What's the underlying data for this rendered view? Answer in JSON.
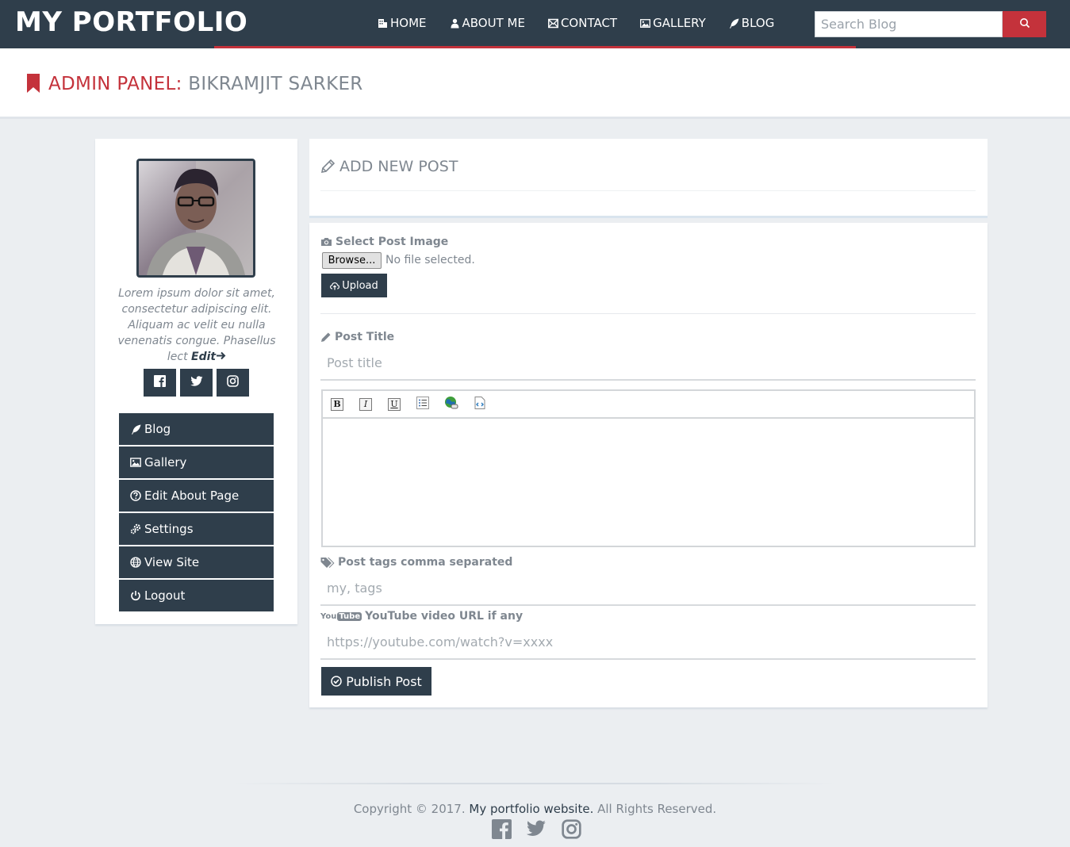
{
  "navbar": {
    "brand": "MY PORTFOLIO",
    "menu": [
      {
        "label": "HOME",
        "icon": "building-icon"
      },
      {
        "label": "ABOUT ME",
        "icon": "user-icon"
      },
      {
        "label": "CONTACT",
        "icon": "envelope-icon"
      },
      {
        "label": "GALLERY",
        "icon": "image-icon"
      },
      {
        "label": "BLOG",
        "icon": "feather-icon"
      }
    ],
    "search_placeholder": "Search Blog",
    "accent_color": "#c4323b",
    "bg_color": "#2f3e4b"
  },
  "header": {
    "accent_label": "ADMIN PANEL:",
    "name": "BIKRAMJIT SARKER"
  },
  "sidebar": {
    "bio": "Lorem ipsum dolor sit amet, consectetur adipiscing elit. Aliquam ac velit eu nulla venenatis congue. Phasellus lect",
    "edit_label": "Edit",
    "social": [
      "facebook-icon",
      "twitter-icon",
      "instagram-icon"
    ],
    "menu": [
      {
        "label": "Blog",
        "icon": "feather-icon"
      },
      {
        "label": "Gallery",
        "icon": "image-icon"
      },
      {
        "label": "Edit About Page",
        "icon": "question-circle-icon"
      },
      {
        "label": "Settings",
        "icon": "gears-icon"
      },
      {
        "label": "View Site",
        "icon": "globe-icon"
      },
      {
        "label": "Logout",
        "icon": "power-icon"
      }
    ]
  },
  "add_post": {
    "title": "ADD NEW POST",
    "image_label": "Select Post Image",
    "browse_label": "Browse...",
    "file_status": "No file selected.",
    "upload_label": "Upload",
    "post_title_label": "Post Title",
    "post_title_placeholder": "Post title",
    "toolbar": [
      "B",
      "I",
      "U"
    ],
    "tags_label": "Post tags comma separated",
    "tags_placeholder": "my, tags",
    "youtube_badge": "You",
    "youtube_badge_tube": "Tube",
    "youtube_label": "YouTube video URL if any",
    "youtube_placeholder": "https://youtube.com/watch?v=xxxx",
    "publish_label": "Publish Post"
  },
  "footer": {
    "copyright_prefix": "Copyright © 2017.",
    "site_name": "My portfolio website.",
    "rights": "All Rights Reserved."
  }
}
